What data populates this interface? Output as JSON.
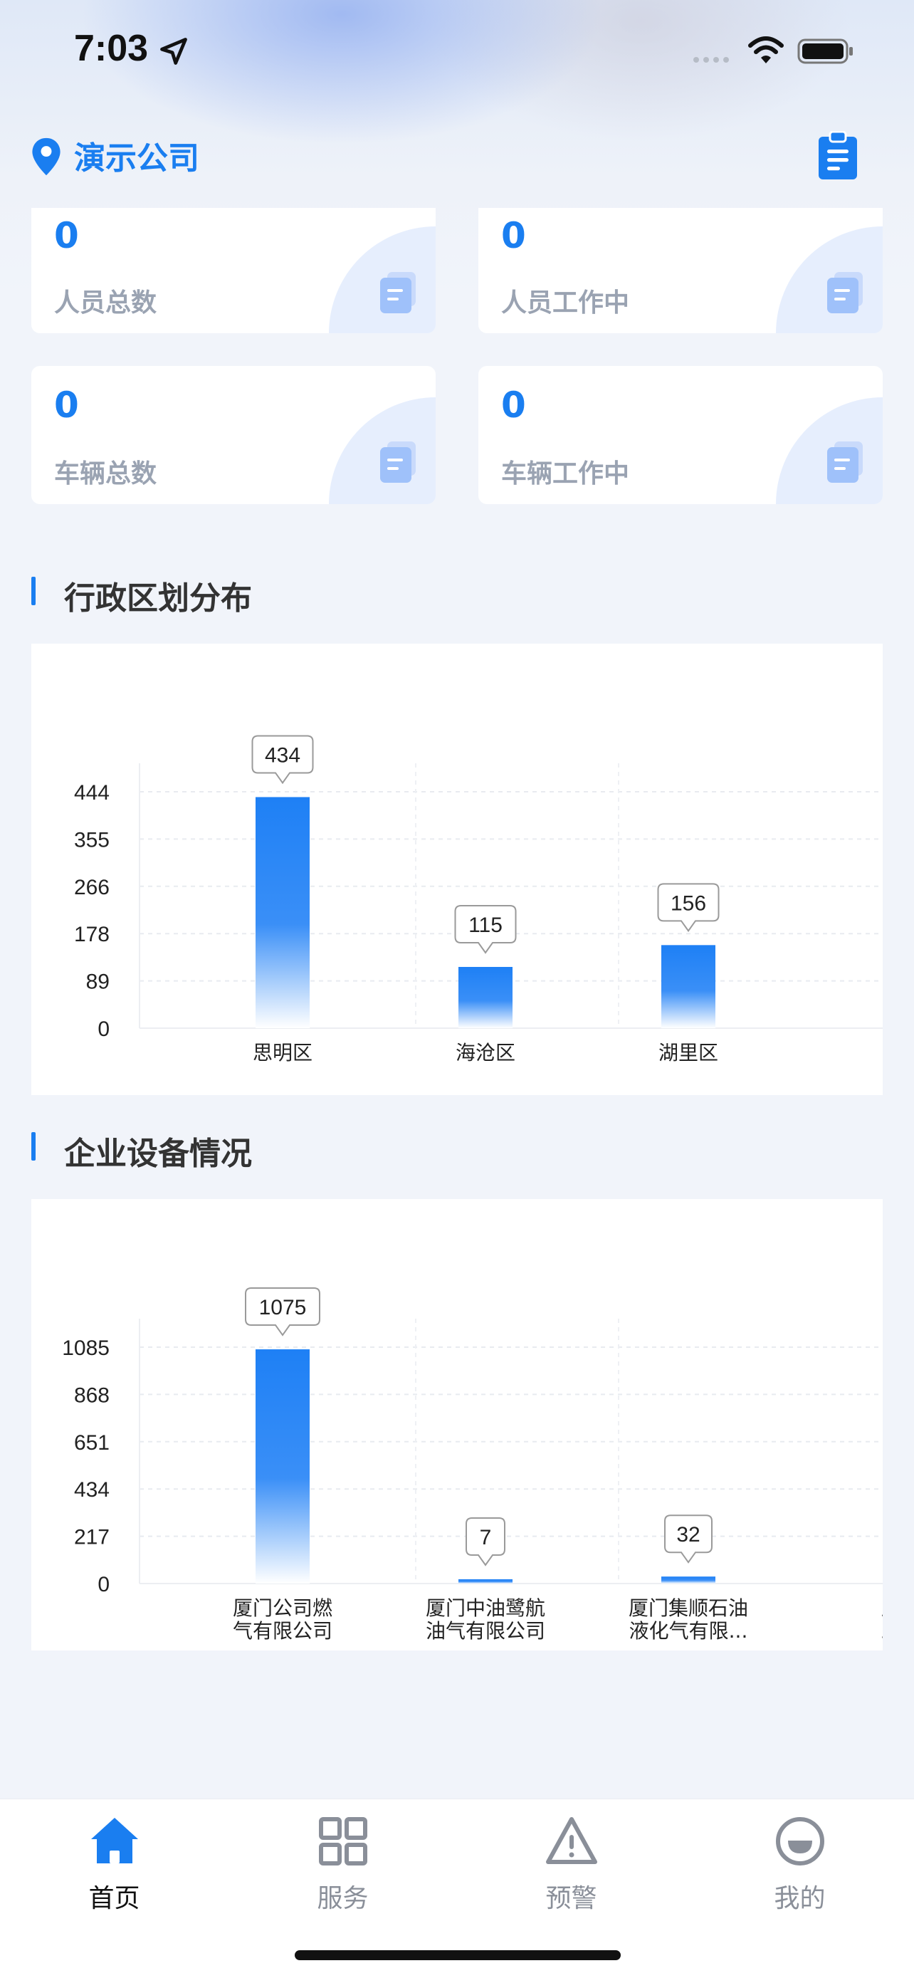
{
  "status_bar": {
    "time": "7:03"
  },
  "header": {
    "company": "演示公司",
    "location_icon": "location-pin-icon",
    "action_icon": "clipboard-icon"
  },
  "stats": [
    {
      "value": "0",
      "label": "人员总数"
    },
    {
      "value": "0",
      "label": "人员工作中"
    },
    {
      "value": "0",
      "label": "车辆总数"
    },
    {
      "value": "0",
      "label": "车辆工作中"
    }
  ],
  "sections": {
    "district_title": "行政区划分布",
    "equipment_title": "企业设备情况"
  },
  "chart_data": [
    {
      "type": "bar",
      "title": "行政区划分布",
      "categories": [
        "思明区",
        "海沧区",
        "湖里区"
      ],
      "values": [
        434,
        115,
        156
      ],
      "value_labels": [
        "434",
        "115",
        "156"
      ],
      "yticks": [
        "0",
        "89",
        "178",
        "266",
        "355",
        "444"
      ],
      "ylim": [
        0,
        444
      ],
      "grid": true,
      "bar_color": "#1e80f5"
    },
    {
      "type": "bar",
      "title": "企业设备情况",
      "categories": [
        [
          "厦门公司燃",
          "气有限公司"
        ],
        [
          "厦门中油鹭航",
          "油气有限公司"
        ],
        [
          "厦门集顺石油",
          "液化气有限..."
        ],
        [
          "厦",
          "工"
        ]
      ],
      "values": [
        1075,
        7,
        32,
        null
      ],
      "value_labels": [
        "1075",
        "7",
        "32",
        ""
      ],
      "yticks": [
        "0",
        "217",
        "434",
        "651",
        "868",
        "1085"
      ],
      "ylim": [
        0,
        1085
      ],
      "grid": true,
      "bar_color": "#1e80f5"
    }
  ],
  "tabbar": [
    {
      "label": "首页",
      "icon": "home-icon",
      "active": true
    },
    {
      "label": "服务",
      "icon": "grid-icon",
      "active": false
    },
    {
      "label": "预警",
      "icon": "warning-icon",
      "active": false
    },
    {
      "label": "我的",
      "icon": "profile-icon",
      "active": false
    }
  ],
  "colors": {
    "accent": "#1a7ef0",
    "muted": "#9aa3b2",
    "background": "#f1f4fa"
  }
}
